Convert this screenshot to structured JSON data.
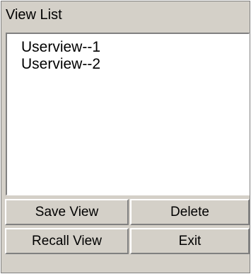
{
  "panel": {
    "title": "View List"
  },
  "list": {
    "items": [
      {
        "label": "Userview--1"
      },
      {
        "label": "Userview--2"
      }
    ]
  },
  "buttons": {
    "save_view": "Save View",
    "delete": "Delete",
    "recall_view": "Recall View",
    "exit": "Exit"
  },
  "colors": {
    "panel_background": "#d4d0c8",
    "list_background": "#ffffff",
    "text": "#000000"
  }
}
